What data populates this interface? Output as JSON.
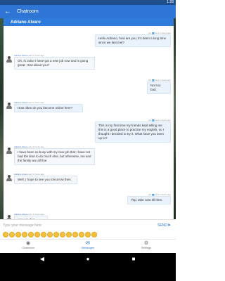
{
  "status_bar": {
    "time": "1:28"
  },
  "app_bar": {
    "title": "Chatroom"
  },
  "window": {
    "title": "Adriano Alvaro"
  },
  "messages": [
    {
      "direction": "out",
      "meta": "por 👥 sent 1 hours ago",
      "text": "Hello Adriano, how are you, it's been a long time since we last met?"
    },
    {
      "direction": "in",
      "name": "Adriano Alvaro",
      "meta": "sent 1 hours ago",
      "text": "Oh, hi Julio! I have got a new job now and is going great. How about you?"
    },
    {
      "direction": "out",
      "meta": "por 👥 sent 1 hours ago",
      "text": "Not too bad."
    },
    {
      "direction": "in",
      "name": "Adriano Alvaro",
      "meta": "sent 1 hours ago",
      "text": "How often do you become online here?"
    },
    {
      "direction": "out",
      "meta": "por 👥 sent 1 hours ago",
      "text": "This is my first time my friends kept telling me this is a good place to practice my english, so I thought I decided to try it. What have you been up to?"
    },
    {
      "direction": "in",
      "name": "Adriano Alvaro",
      "meta": "sent 1 hours ago",
      "text": "I have been so busy with my new job that I have not had the time to do much else, but otherwise, me and the family are all fine."
    },
    {
      "direction": "in",
      "name": "Adriano Alvaro",
      "meta": "sent 1 hours ago",
      "text": "Well, I hope to see you tomorrow then."
    },
    {
      "direction": "out",
      "meta": "por 👥 sent 1 hours ago",
      "text": "Yep, take care till then."
    },
    {
      "direction": "in",
      "name": "Adriano Alvaro",
      "meta": "sent 1 hours ago",
      "text": "yes, you too."
    }
  ],
  "compose": {
    "placeholder": "Type your message here",
    "send_label": "SEND"
  },
  "bottom_nav": [
    {
      "label": "Chatroom",
      "icon": "chat-icon"
    },
    {
      "label": "Messages",
      "icon": "messages-icon"
    },
    {
      "label": "Settings",
      "icon": "gear-icon"
    }
  ],
  "colors": {
    "primary": "#2e75d6",
    "status_bar": "#1f4f8a",
    "bubble_out": "#eaf2fd",
    "bubble_in": "#f4f7fb"
  }
}
